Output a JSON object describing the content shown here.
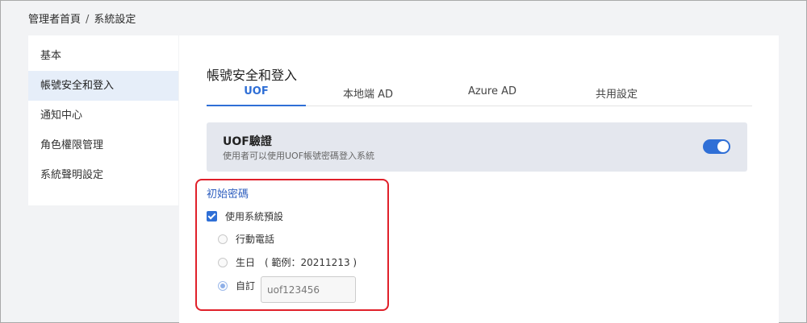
{
  "breadcrumb": {
    "home": "管理者首頁",
    "separator": "/",
    "current": "系統設定"
  },
  "sidebar": {
    "items": [
      {
        "label": "基本",
        "active": false
      },
      {
        "label": "帳號安全和登入",
        "active": true
      },
      {
        "label": "通知中心",
        "active": false
      },
      {
        "label": "角色權限管理",
        "active": false
      },
      {
        "label": "系統聲明設定",
        "active": false
      }
    ]
  },
  "main": {
    "title": "帳號安全和登入",
    "tabs": [
      {
        "label": "UOF",
        "active": true
      },
      {
        "label": "本地端 AD",
        "active": false
      },
      {
        "label": "Azure AD",
        "active": false
      },
      {
        "label": "共用設定",
        "active": false
      }
    ],
    "uof_auth": {
      "title": "UOF驗證",
      "description": "使用者可以使用UOF帳號密碼登入系統",
      "enabled": true
    },
    "initial_password": {
      "title": "初始密碼",
      "use_default_label": "使用系統預設",
      "use_default_checked": true,
      "options": [
        {
          "label": "行動電話",
          "checked": false
        },
        {
          "label": "生日",
          "example": "( 範例：20211213 )",
          "checked": false
        },
        {
          "label": "自訂",
          "checked": true
        }
      ],
      "custom_value": "uof123456"
    }
  },
  "colors": {
    "accent": "#2f6fd6",
    "highlight_border": "#e0202a",
    "active_sidebar_bg": "#e6eef9",
    "card_bg": "#e4e7ee"
  }
}
